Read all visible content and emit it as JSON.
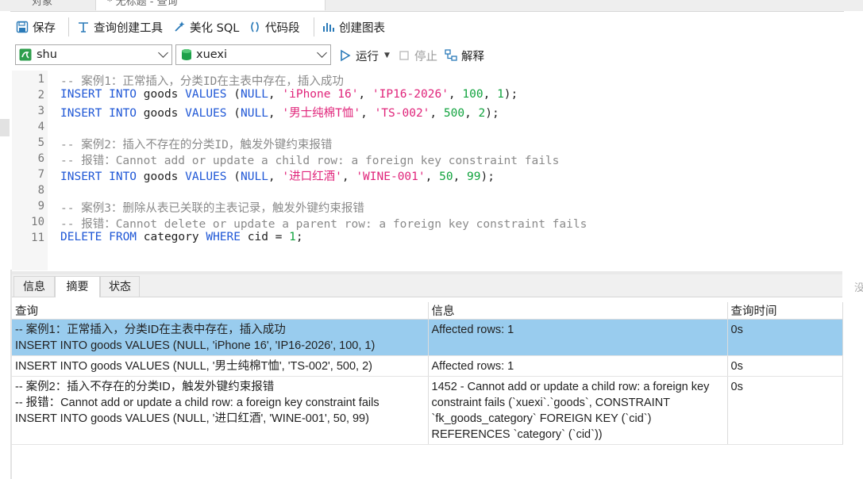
{
  "tabs": {
    "objects": "对象",
    "query": "* 无标题 - 查询"
  },
  "toolbar": {
    "save": "保存",
    "query_builder": "查询创建工具",
    "beautify": "美化 SQL",
    "snippet": "代码段",
    "create_chart": "创建图表"
  },
  "connection": {
    "value": "shu"
  },
  "database": {
    "value": "xuexi"
  },
  "run_bar": {
    "run": "运行",
    "stop": "停止",
    "explain": "解释"
  },
  "editor": {
    "line_numbers": [
      "1",
      "2",
      "3",
      "4",
      "5",
      "6",
      "7",
      "8",
      "9",
      "10",
      "11"
    ],
    "line1": "-- 案例1：正常插入，分类ID在主表中存在，插入成功",
    "line2": {
      "k1": "INSERT INTO",
      "t1": " goods ",
      "k2": "VALUES",
      "p1": " (",
      "k3": "NULL",
      "c1": ", ",
      "s1": "'iPhone 16'",
      "c2": ", ",
      "s2": "'IP16-2026'",
      "c3": ", ",
      "n1": "100",
      "c4": ", ",
      "n2": "1",
      "p2": ");"
    },
    "line3": {
      "k1": "INSERT INTO",
      "t1": " goods ",
      "k2": "VALUES",
      "p1": " (",
      "k3": "NULL",
      "c1": ", ",
      "s1": "'男士纯棉T恤'",
      "c2": ", ",
      "s2": "'TS-002'",
      "c3": ", ",
      "n1": "500",
      "c4": ", ",
      "n2": "2",
      "p2": ");"
    },
    "line5": "-- 案例2：插入不存在的分类ID，触发外键约束报错",
    "line6": "-- 报错：Cannot add or update a child row: a foreign key constraint fails",
    "line7": {
      "k1": "INSERT INTO",
      "t1": " goods ",
      "k2": "VALUES",
      "p1": " (",
      "k3": "NULL",
      "c1": ", ",
      "s1": "'进口红酒'",
      "c2": ", ",
      "s2": "'WINE-001'",
      "c3": ", ",
      "n1": "50",
      "c4": ", ",
      "n2": "99",
      "p2": ");"
    },
    "line9": "-- 案例3：删除从表已关联的主表记录，触发外键约束报错",
    "line10": "-- 报错：Cannot delete or update a parent row: a foreign key constraint fails",
    "line11": {
      "k1": "DELETE FROM",
      "t1": " category ",
      "k2": "WHERE",
      "t2": " cid = ",
      "n1": "1",
      "p1": ";"
    }
  },
  "result_tabs": [
    "信息",
    "摘要",
    "状态"
  ],
  "results": {
    "headers": [
      "查询",
      "信息",
      "查询时间"
    ],
    "rows": [
      {
        "query": [
          "-- 案例1：正常插入，分类ID在主表中存在，插入成功",
          "INSERT INTO goods VALUES (NULL, 'iPhone 16', 'IP16-2026', 100, 1)"
        ],
        "info": "Affected rows: 1",
        "time": "0s"
      },
      {
        "query": [
          "INSERT INTO goods VALUES (NULL, '男士纯棉T恤', 'TS-002', 500, 2)"
        ],
        "info": "Affected rows: 1",
        "time": "0s"
      },
      {
        "query": [
          "-- 案例2：插入不存在的分类ID，触发外键约束报错",
          "-- 报错：Cannot add or update a child row: a foreign key constraint fails",
          "INSERT INTO goods VALUES (NULL, '进口红酒', 'WINE-001', 50, 99)"
        ],
        "info": "1452 - Cannot add or update a child row: a foreign key constraint fails (`xuexi`.`goods`, CONSTRAINT `fk_goods_category` FOREIGN KEY (`cid`) REFERENCES `category` (`cid`))",
        "time": "0s"
      }
    ]
  },
  "side_hint": "没",
  "colors": {
    "selected_row": "#99ccee",
    "keyword": "#1f57d6",
    "string": "#e0247a",
    "number": "#11a33e",
    "comment": "#8a8a8a"
  }
}
